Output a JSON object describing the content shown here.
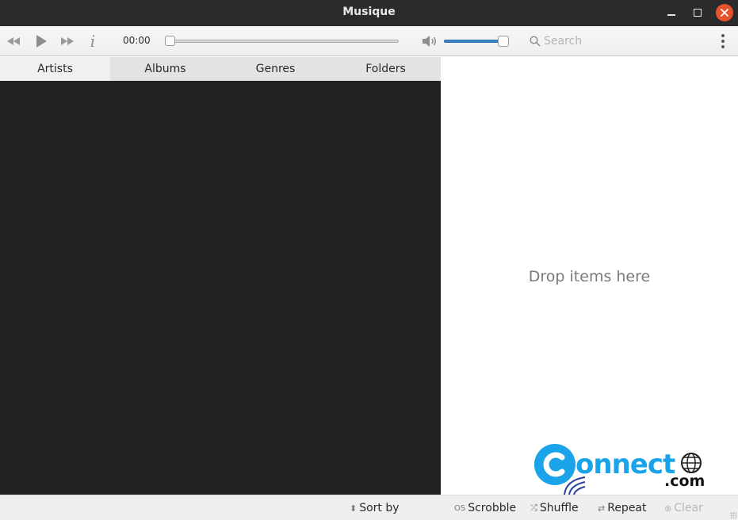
{
  "window": {
    "title": "Musique",
    "controls": [
      "minimize",
      "maximize",
      "close"
    ],
    "close_color": "#e9532c"
  },
  "toolbar": {
    "buttons": [
      {
        "name": "previous",
        "icon": "skip-back-icon"
      },
      {
        "name": "play",
        "icon": "play-icon"
      },
      {
        "name": "next",
        "icon": "skip-forward-icon"
      },
      {
        "name": "info",
        "icon": "info-icon"
      }
    ],
    "time": "00:00",
    "seek_progress": 0,
    "volume_level": 1.0,
    "volume_color": "#3a86c8",
    "search_placeholder": "Search",
    "search_value": ""
  },
  "tabs": [
    {
      "label": "Artists",
      "active": true
    },
    {
      "label": "Albums",
      "active": false
    },
    {
      "label": "Genres",
      "active": false
    },
    {
      "label": "Folders",
      "active": false
    }
  ],
  "playlist": {
    "empty_text": "Drop items here"
  },
  "watermark": {
    "text_main": "onnect",
    "text_sub": ".com",
    "color": "#1aa3e8"
  },
  "statusbar": {
    "sort_by": "Sort by",
    "scrobble": "Scrobble",
    "shuffle": "Shuffle",
    "repeat": "Repeat",
    "clear": "Clear"
  }
}
